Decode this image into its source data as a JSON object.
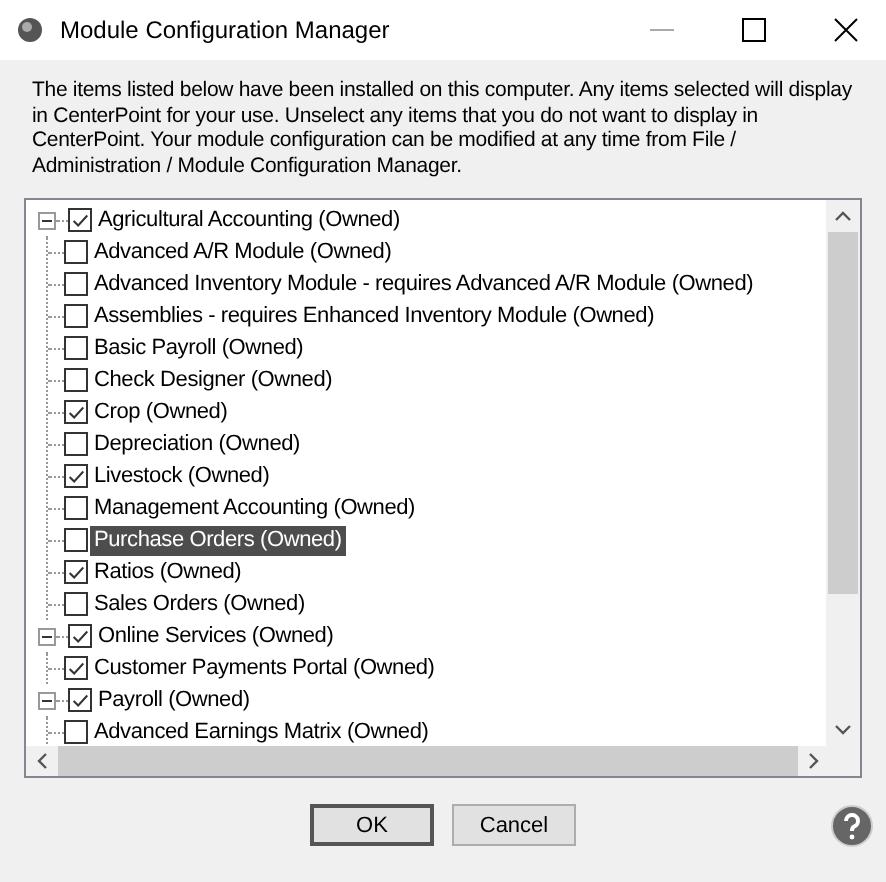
{
  "window": {
    "title": "Module Configuration Manager"
  },
  "intro": "The items listed below have been installed on this computer.  Any items selected will display in CenterPoint for your use.  Unselect any items that you do not want to display in CenterPoint.  Your module configuration can be modified at any time from File / Administration / Module Configuration Manager.",
  "tree": [
    {
      "label": "Agricultural Accounting (Owned)",
      "checked": true,
      "expanded": true,
      "selected": false,
      "children": [
        {
          "label": "Advanced A/R Module (Owned)",
          "checked": false,
          "selected": false
        },
        {
          "label": "Advanced Inventory Module - requires Advanced A/R Module (Owned)",
          "checked": false,
          "selected": false
        },
        {
          "label": "Assemblies - requires Enhanced Inventory Module (Owned)",
          "checked": false,
          "selected": false
        },
        {
          "label": "Basic Payroll (Owned)",
          "checked": false,
          "selected": false
        },
        {
          "label": "Check Designer (Owned)",
          "checked": false,
          "selected": false
        },
        {
          "label": "Crop (Owned)",
          "checked": true,
          "selected": false
        },
        {
          "label": "Depreciation (Owned)",
          "checked": false,
          "selected": false
        },
        {
          "label": "Livestock (Owned)",
          "checked": true,
          "selected": false
        },
        {
          "label": "Management Accounting (Owned)",
          "checked": false,
          "selected": false
        },
        {
          "label": "Purchase Orders (Owned)",
          "checked": false,
          "selected": true
        },
        {
          "label": "Ratios (Owned)",
          "checked": true,
          "selected": false
        },
        {
          "label": "Sales Orders (Owned)",
          "checked": false,
          "selected": false
        }
      ]
    },
    {
      "label": "Online Services (Owned)",
      "checked": true,
      "expanded": true,
      "selected": false,
      "children": [
        {
          "label": "Customer Payments Portal (Owned)",
          "checked": true,
          "selected": false
        }
      ]
    },
    {
      "label": "Payroll (Owned)",
      "checked": true,
      "expanded": true,
      "selected": false,
      "children": [
        {
          "label": "Advanced Earnings Matrix (Owned)",
          "checked": false,
          "selected": false
        }
      ]
    }
  ],
  "buttons": [
    "OK",
    "Cancel"
  ]
}
